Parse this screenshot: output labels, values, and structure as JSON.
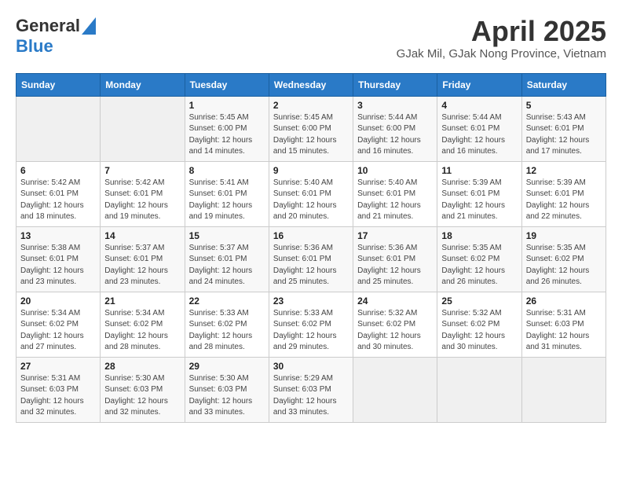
{
  "header": {
    "logo_line1": "General",
    "logo_line2": "Blue",
    "month": "April 2025",
    "location": "GJak Mil, GJak Nong Province, Vietnam"
  },
  "calendar": {
    "days_of_week": [
      "Sunday",
      "Monday",
      "Tuesday",
      "Wednesday",
      "Thursday",
      "Friday",
      "Saturday"
    ],
    "weeks": [
      [
        {
          "day": "",
          "info": ""
        },
        {
          "day": "",
          "info": ""
        },
        {
          "day": "1",
          "info": "Sunrise: 5:45 AM\nSunset: 6:00 PM\nDaylight: 12 hours\nand 14 minutes."
        },
        {
          "day": "2",
          "info": "Sunrise: 5:45 AM\nSunset: 6:00 PM\nDaylight: 12 hours\nand 15 minutes."
        },
        {
          "day": "3",
          "info": "Sunrise: 5:44 AM\nSunset: 6:00 PM\nDaylight: 12 hours\nand 16 minutes."
        },
        {
          "day": "4",
          "info": "Sunrise: 5:44 AM\nSunset: 6:01 PM\nDaylight: 12 hours\nand 16 minutes."
        },
        {
          "day": "5",
          "info": "Sunrise: 5:43 AM\nSunset: 6:01 PM\nDaylight: 12 hours\nand 17 minutes."
        }
      ],
      [
        {
          "day": "6",
          "info": "Sunrise: 5:42 AM\nSunset: 6:01 PM\nDaylight: 12 hours\nand 18 minutes."
        },
        {
          "day": "7",
          "info": "Sunrise: 5:42 AM\nSunset: 6:01 PM\nDaylight: 12 hours\nand 19 minutes."
        },
        {
          "day": "8",
          "info": "Sunrise: 5:41 AM\nSunset: 6:01 PM\nDaylight: 12 hours\nand 19 minutes."
        },
        {
          "day": "9",
          "info": "Sunrise: 5:40 AM\nSunset: 6:01 PM\nDaylight: 12 hours\nand 20 minutes."
        },
        {
          "day": "10",
          "info": "Sunrise: 5:40 AM\nSunset: 6:01 PM\nDaylight: 12 hours\nand 21 minutes."
        },
        {
          "day": "11",
          "info": "Sunrise: 5:39 AM\nSunset: 6:01 PM\nDaylight: 12 hours\nand 21 minutes."
        },
        {
          "day": "12",
          "info": "Sunrise: 5:39 AM\nSunset: 6:01 PM\nDaylight: 12 hours\nand 22 minutes."
        }
      ],
      [
        {
          "day": "13",
          "info": "Sunrise: 5:38 AM\nSunset: 6:01 PM\nDaylight: 12 hours\nand 23 minutes."
        },
        {
          "day": "14",
          "info": "Sunrise: 5:37 AM\nSunset: 6:01 PM\nDaylight: 12 hours\nand 23 minutes."
        },
        {
          "day": "15",
          "info": "Sunrise: 5:37 AM\nSunset: 6:01 PM\nDaylight: 12 hours\nand 24 minutes."
        },
        {
          "day": "16",
          "info": "Sunrise: 5:36 AM\nSunset: 6:01 PM\nDaylight: 12 hours\nand 25 minutes."
        },
        {
          "day": "17",
          "info": "Sunrise: 5:36 AM\nSunset: 6:01 PM\nDaylight: 12 hours\nand 25 minutes."
        },
        {
          "day": "18",
          "info": "Sunrise: 5:35 AM\nSunset: 6:02 PM\nDaylight: 12 hours\nand 26 minutes."
        },
        {
          "day": "19",
          "info": "Sunrise: 5:35 AM\nSunset: 6:02 PM\nDaylight: 12 hours\nand 26 minutes."
        }
      ],
      [
        {
          "day": "20",
          "info": "Sunrise: 5:34 AM\nSunset: 6:02 PM\nDaylight: 12 hours\nand 27 minutes."
        },
        {
          "day": "21",
          "info": "Sunrise: 5:34 AM\nSunset: 6:02 PM\nDaylight: 12 hours\nand 28 minutes."
        },
        {
          "day": "22",
          "info": "Sunrise: 5:33 AM\nSunset: 6:02 PM\nDaylight: 12 hours\nand 28 minutes."
        },
        {
          "day": "23",
          "info": "Sunrise: 5:33 AM\nSunset: 6:02 PM\nDaylight: 12 hours\nand 29 minutes."
        },
        {
          "day": "24",
          "info": "Sunrise: 5:32 AM\nSunset: 6:02 PM\nDaylight: 12 hours\nand 30 minutes."
        },
        {
          "day": "25",
          "info": "Sunrise: 5:32 AM\nSunset: 6:02 PM\nDaylight: 12 hours\nand 30 minutes."
        },
        {
          "day": "26",
          "info": "Sunrise: 5:31 AM\nSunset: 6:03 PM\nDaylight: 12 hours\nand 31 minutes."
        }
      ],
      [
        {
          "day": "27",
          "info": "Sunrise: 5:31 AM\nSunset: 6:03 PM\nDaylight: 12 hours\nand 32 minutes."
        },
        {
          "day": "28",
          "info": "Sunrise: 5:30 AM\nSunset: 6:03 PM\nDaylight: 12 hours\nand 32 minutes."
        },
        {
          "day": "29",
          "info": "Sunrise: 5:30 AM\nSunset: 6:03 PM\nDaylight: 12 hours\nand 33 minutes."
        },
        {
          "day": "30",
          "info": "Sunrise: 5:29 AM\nSunset: 6:03 PM\nDaylight: 12 hours\nand 33 minutes."
        },
        {
          "day": "",
          "info": ""
        },
        {
          "day": "",
          "info": ""
        },
        {
          "day": "",
          "info": ""
        }
      ]
    ]
  }
}
